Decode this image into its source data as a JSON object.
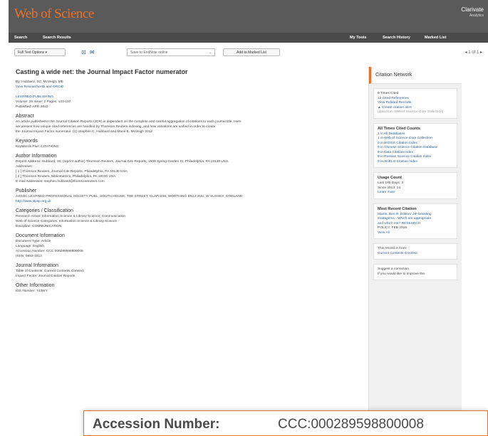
{
  "header": {
    "logo": "Web of Science",
    "brand_name": "Clarivate",
    "brand_sub": "Analytics"
  },
  "subnav": {
    "search": "Search",
    "search_results": "Search Results",
    "my_tools": "My Tools",
    "search_history": "Search History",
    "marked_list": "Marked List"
  },
  "toolbar": {
    "full_text_options": "Full Text Options ▾",
    "save_select": "Save to EndNote online",
    "add_marked": "Add to Marked List",
    "pager": "◂ 1 of 1 ▸"
  },
  "record": {
    "title": "Casting a wide net: the Journal Impact Factor numerator",
    "authors": "By: Hubbard, SC; McVeigh, ME",
    "view_researcher": "View ResearcherID and ORCID",
    "publisher_name": "LEARNED PUBLISHING",
    "volume": "Volume: 25   Issue: 2   Pages: 133-137",
    "published": "Published: APR 2012",
    "abstract_title": "Abstract",
    "abstract_lines": [
      "An article published in the Journal Citation Reports (JCR) is dependent on the complete and careful aggregation of citations to each journal title. Here",
      "we present how unique cited references are handled by Thomson Reuters indexing, and how variations are unified in order to create",
      "the Journal Impact Factor numerator. (C) Stephen C. Hubbard and Marie E. McVeigh 2012"
    ],
    "keywords_title": "Keywords",
    "keywords": "KeyWords Plus: CITATIONS",
    "author_info_title": "Author Information",
    "reprint": "Reprint Address: Hubbard, SC (reprint author) Thomson Reuters, Journal Cite Reports, 1500 Spring Garden St, Philadelphia, PA 19130 USA.",
    "addresses_label": "Addresses:",
    "address_1": "[ 1 ] Thomson Reuters, Journal Cite Reports, Philadelphia, PA 19130 USA",
    "address_2": "[ 2 ] Thomson Reuters, Bibliometrics, Philadelphia, PA 19130 USA",
    "email": "E-mail Addresses: stephen.hubbard@thomsonreuters.com",
    "publisher_title": "Publisher",
    "publisher_address": "ASSOC LEARNED PROFESSIONAL SOCIETY PUBL, SOUTH HOUSE, THE STREET, CLAPHAM, WORTHING BN13 3UU, W SUSSEX, ENGLAND",
    "publisher_link": "http://www.alpsp.org.uk",
    "categories_title": "Categories / Classification",
    "research_areas": "Research Areas: Information Science & Library Science; Communication",
    "wos_categories": "Web of Science Categories: Information Science & Library Science",
    "discipline": "Discipline: COMMUNICATION",
    "docinfo_title": "Document Information",
    "doc_type": "Document Type: Article",
    "language": "Language: English",
    "accession": "Accession Number: CCC:000289598800008",
    "issn": "ISSN: 0953-1513",
    "journal_title": "Journal Information",
    "table_contents": "Table of Contents: Current Contents Connect",
    "impact_factor": "Impact Factor: Journal Citation Reports",
    "other_title": "Other Information",
    "ids_number": "IDS Number: 743WY"
  },
  "sidebar": {
    "head": "Citation Network",
    "cited_by": "0 Times Cited",
    "refs": "12 Cited References",
    "view_related": "View Related Records",
    "alert": "Create citation alert",
    "alert_sub": "(data from Web of Science Core Collection)",
    "all_counts_title": "All Times Cited Counts",
    "counts": [
      "1 in All Databases",
      "1 in Web of Science Core Collection",
      "0 in BIOSIS Citation Index",
      "0 in Chinese Science Citation Database",
      "0 in Data Citation Index",
      "0 in Russian Science Citation Index",
      "0 in SciELO Citation Index"
    ],
    "usage_title": "Usage Count",
    "usage_1": "Last 180 Days: 3",
    "usage_2": "Since 2013: 14",
    "usage_link": "Learn more",
    "recent_title": "Most Recent Citation",
    "recent_1": "Martin, Ben R. Editors' JIF-boosting",
    "recent_2": "stratagems - Which are appropriate",
    "recent_3": "and which not?  RESEARCH",
    "recent_4": "POLICY, FEB 2016.",
    "recent_link": "View All",
    "record_from": "This record is from:",
    "record_from_2": "Current Contents Connect",
    "suggest": "Suggest a correction",
    "suggest_2": "If you would like to improve the"
  },
  "callout": {
    "label": "Accession Number:",
    "value": "CCC:000289598800008"
  },
  "colors": {
    "brand_orange": "#e8722b",
    "header_gray": "#5a5a5a",
    "link_blue": "#2b5c8f"
  }
}
